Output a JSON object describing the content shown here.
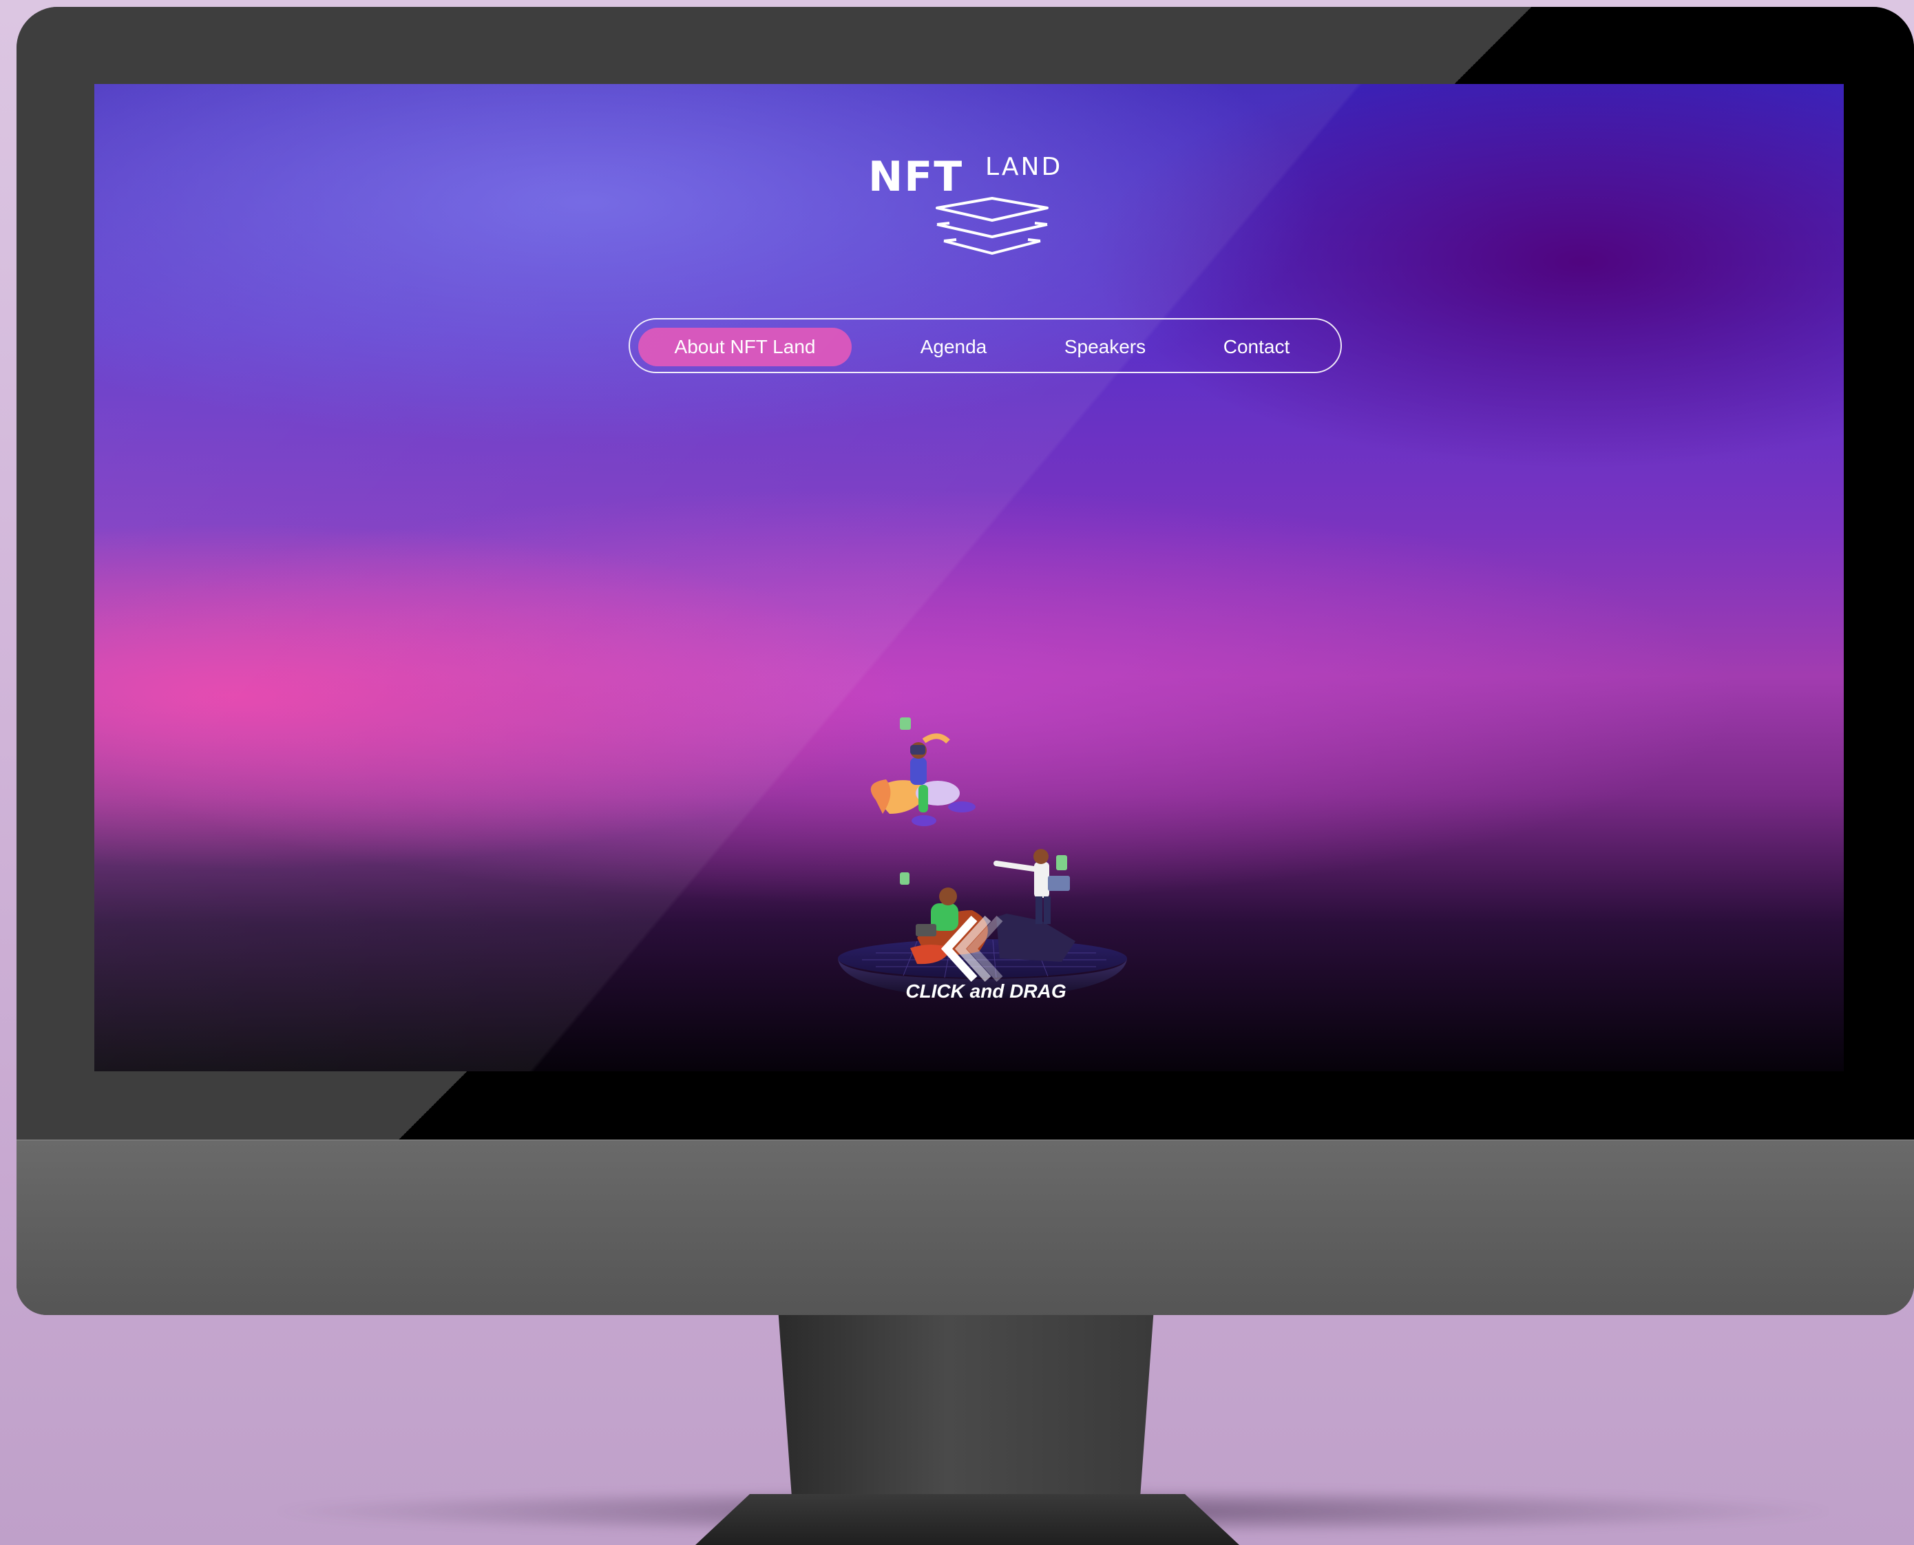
{
  "site": {
    "logo": {
      "part1": "NFT",
      "part2": "LAND"
    },
    "nav": {
      "items": [
        {
          "label": "About NFT Land",
          "active": true
        },
        {
          "label": "Agenda",
          "active": false
        },
        {
          "label": "Speakers",
          "active": false
        },
        {
          "label": "Contact",
          "active": false
        }
      ]
    },
    "hero": {
      "hint_icon": "chevrons-left-icon",
      "hint_text": "CLICK and DRAG"
    }
  },
  "colors": {
    "accent": "#d44bb8",
    "background_top": "#3a22b8",
    "background_pink": "#e03ca8",
    "background_bottom": "#06020a",
    "device_body": "#3e3e3e",
    "wall": "#d2b7da"
  }
}
